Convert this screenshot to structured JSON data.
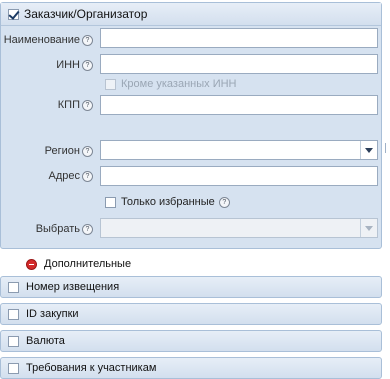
{
  "customer_panel": {
    "title": "Заказчик/Организатор",
    "fields": {
      "name_label": "Наименование",
      "inn_label": "ИНН",
      "except_inn_label": "Кроме указанных ИНН",
      "kpp_label": "КПП",
      "region_label": "Регион",
      "address_label": "Адрес",
      "only_favorites_label": "Только избранные",
      "choose_label": "Выбрать"
    },
    "help_glyph": "?"
  },
  "additional": {
    "label": "Дополнительные"
  },
  "sections": [
    {
      "label": "Номер извещения"
    },
    {
      "label": "ID закупки"
    },
    {
      "label": "Валюта"
    },
    {
      "label": "Требования к участникам"
    }
  ]
}
